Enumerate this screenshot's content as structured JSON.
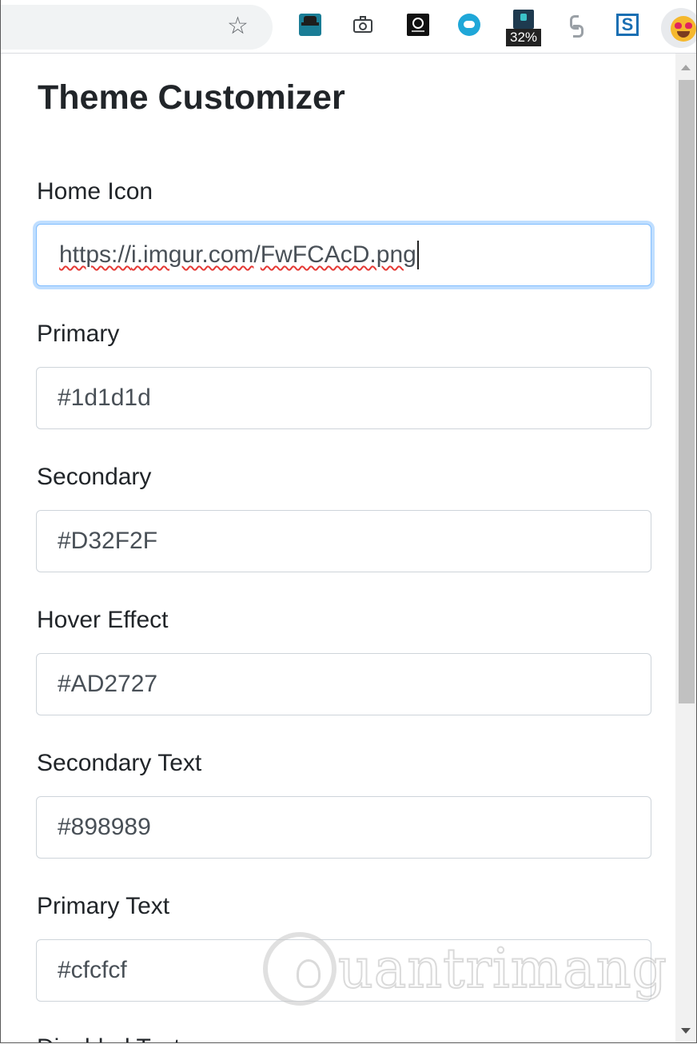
{
  "toolbar": {
    "bookmark_star": "☆",
    "battery_percent": "32%",
    "extensions": [
      "spy-extension-icon",
      "camera-icon",
      "screen-recorder-icon",
      "cloud-sync-icon",
      "battery-status-icon",
      "hook-extension-icon",
      "s-extension-icon",
      "heart-eyes-emoji-icon"
    ]
  },
  "page": {
    "title": "Theme Customizer"
  },
  "fields": [
    {
      "label": "Home Icon",
      "value": "https://i.imgur.com/FwFCAcD.png",
      "focused": true
    },
    {
      "label": "Primary",
      "value": "#1d1d1d"
    },
    {
      "label": "Secondary",
      "value": "#D32F2F"
    },
    {
      "label": "Hover Effect",
      "value": "#AD2727"
    },
    {
      "label": "Secondary Text",
      "value": "#898989"
    },
    {
      "label": "Primary Text",
      "value": "#cfcfcf"
    },
    {
      "label": "Disabled Text",
      "value": ""
    }
  ],
  "home_icon_url_parts": {
    "p1": "https://",
    "p2": "i.imgur.com",
    "p3": "/",
    "p4": "FwFCAcD.png"
  },
  "watermark": {
    "text": "uantrimang"
  },
  "colors": {
    "focus_border": "#80bdff",
    "spellcheck": "#e53935",
    "text": "#212529"
  }
}
